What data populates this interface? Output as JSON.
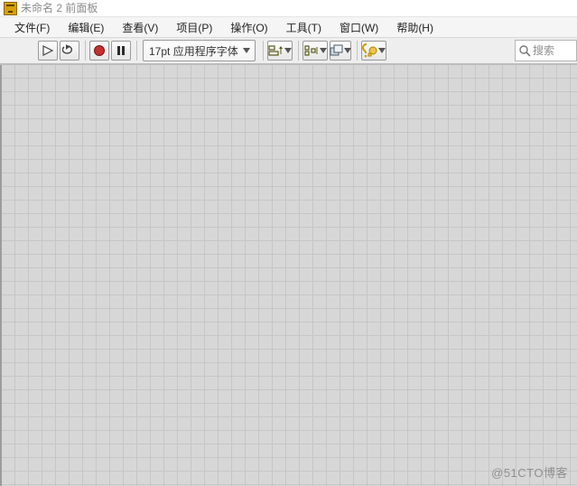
{
  "window": {
    "title": "未命名 2 前面板"
  },
  "menubar": {
    "items": [
      {
        "label": "文件(F)"
      },
      {
        "label": "编辑(E)"
      },
      {
        "label": "查看(V)"
      },
      {
        "label": "项目(P)"
      },
      {
        "label": "操作(O)"
      },
      {
        "label": "工具(T)"
      },
      {
        "label": "窗口(W)"
      },
      {
        "label": "帮助(H)"
      }
    ]
  },
  "toolbar": {
    "run_name": "run-arrow-icon",
    "run_cont_name": "run-continuous-icon",
    "abort_name": "abort-icon",
    "pause_name": "pause-icon",
    "font_label": "17pt 应用程序字体",
    "align_name": "align-objects-icon",
    "distribute_name": "distribute-objects-icon",
    "reorder_name": "reorder-icon",
    "help_name": "context-help-icon"
  },
  "search": {
    "placeholder": "搜索"
  },
  "watermark": "@51CTO博客"
}
